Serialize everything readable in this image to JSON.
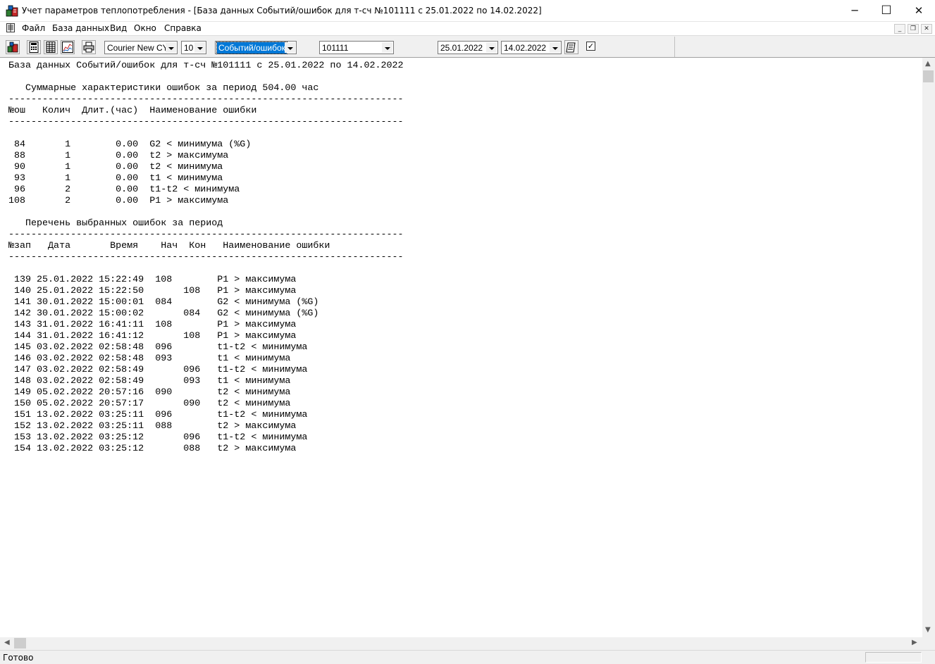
{
  "window": {
    "title": "Учет параметров теплопотребления - [База данных Событий/ошибок для т-сч №101111 с 25.01.2022 по 14.02.2022]",
    "icon": "app-heat-meter-icon",
    "minimize_glyph": "─",
    "maximize_glyph": "☐",
    "close_glyph": "✕"
  },
  "menu": {
    "items": [
      "Файл",
      "База данных",
      "Вид",
      "Окно",
      "Справка"
    ],
    "mdi_minimize": "_",
    "mdi_restore": "❐",
    "mdi_close": "✕"
  },
  "toolbar": {
    "buttons": [
      "open-db-icon",
      "calculator-icon",
      "table-icon",
      "graph-icon",
      "print-icon"
    ],
    "font_name": "Courier New CYR",
    "font_size": "10",
    "db_type": "Событий/ошибок",
    "meter_number": "101111",
    "date_from": "25.01.2022",
    "date_to": "14.02.2022",
    "apply_icon": "notepad-icon",
    "checkbox_checked": true,
    "check_glyph": "✓"
  },
  "report": {
    "header": "База данных Событий/ошибок для т-сч №101111 с 25.01.2022 по 14.02.2022",
    "summary_title": "   Суммарные характеристики ошибок за период 504.00 час",
    "separator": "----------------------------------------------------------------------",
    "summary_columns": "№ош   Колич  Длит.(час)  Наименование ошибки",
    "summary_rows": [
      " 84       1        0.00  G2 < минимума (%G)",
      " 88       1        0.00  t2 > максимума",
      " 90       1        0.00  t2 < минимума",
      " 93       1        0.00  t1 < минимума",
      " 96       2        0.00  t1-t2 < минимума",
      "108       2        0.00  P1 > максимума"
    ],
    "list_title": "   Перечень выбранных ошибок за период",
    "list_columns": "№зап   Дата       Время    Нач  Кон   Наименование ошибки",
    "list_rows": [
      " 139 25.01.2022 15:22:49  108        P1 > максимума",
      " 140 25.01.2022 15:22:50       108   P1 > максимума",
      " 141 30.01.2022 15:00:01  084        G2 < минимума (%G)",
      " 142 30.01.2022 15:00:02       084   G2 < минимума (%G)",
      " 143 31.01.2022 16:41:11  108        P1 > максимума",
      " 144 31.01.2022 16:41:12       108   P1 > максимума",
      " 145 03.02.2022 02:58:48  096        t1-t2 < минимума",
      " 146 03.02.2022 02:58:48  093        t1 < минимума",
      " 147 03.02.2022 02:58:49       096   t1-t2 < минимума",
      " 148 03.02.2022 02:58:49       093   t1 < минимума",
      " 149 05.02.2022 20:57:16  090        t2 < минимума",
      " 150 05.02.2022 20:57:17       090   t2 < минимума",
      " 151 13.02.2022 03:25:11  096        t1-t2 < минимума",
      " 152 13.02.2022 03:25:11  088        t2 > максимума",
      " 153 13.02.2022 03:25:12       096   t1-t2 < минимума",
      " 154 13.02.2022 03:25:12       088   t2 > максимума"
    ]
  },
  "status": {
    "text": "Готово"
  }
}
